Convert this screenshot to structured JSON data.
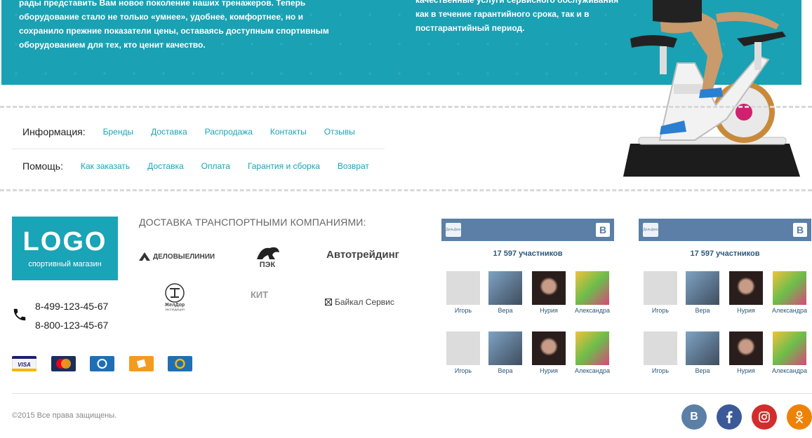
{
  "banner": {
    "left_text": "рады представить Вам новое поколение наших тренажеров. Теперь оборудование стало не только «умнее», удобнее, комфортнее, но и сохранило прежние показатели цены, оставаясь доступным спортивным оборудованием для тех, кто ценит качество.",
    "right_text": "качественные услуги сервисного обслуживания как в течение гарантийного срока, так и в постгарантийный период."
  },
  "info": {
    "title": "Информация:",
    "links": [
      "Бренды",
      "Доставка",
      "Распродажа",
      "Контакты",
      "Отзывы"
    ]
  },
  "help": {
    "title": "Помощь:",
    "links": [
      "Как заказать",
      "Доставка",
      "Оплата",
      "Гарантия и сборка",
      "Возврат"
    ]
  },
  "logo": {
    "main": "LOGO",
    "sub": "спортивный магазин"
  },
  "phones": [
    "8-499-123-45-67",
    "8-800-123-45-67"
  ],
  "payments": [
    "visa-icon",
    "mastercard-icon",
    "webmoney-icon",
    "yandex-money-icon",
    "qiwi-icon"
  ],
  "shipping": {
    "title": "ДОСТАВКА ТРАНСПОРТНЫМИ КОМПАНИЯМИ:",
    "companies": [
      "ДЕЛОВЫЕЛИНИИ",
      "ПЭК",
      "Автотрейдинг",
      "ЖелДор",
      "КИТ",
      "Байкал Сервис"
    ],
    "tagline": "ЭКСПЕДИЦИЯ"
  },
  "vk": {
    "header_label": "Дельфин",
    "count": "17 597 участников",
    "members": [
      "Игорь",
      "Вера",
      "Нурия",
      "Александра",
      "Игорь",
      "Вера",
      "Нурия",
      "Александра"
    ]
  },
  "footer": {
    "copyright": "©2015 Все права защищены."
  },
  "social": [
    "vk-icon",
    "facebook-icon",
    "instagram-icon",
    "odnoklassniki-icon"
  ],
  "colors": {
    "accent": "#19a4b7",
    "vk": "#5b7fa6",
    "facebook": "#3b5998",
    "instagram": "#d22d2d",
    "odnoklassniki": "#ee8208"
  }
}
